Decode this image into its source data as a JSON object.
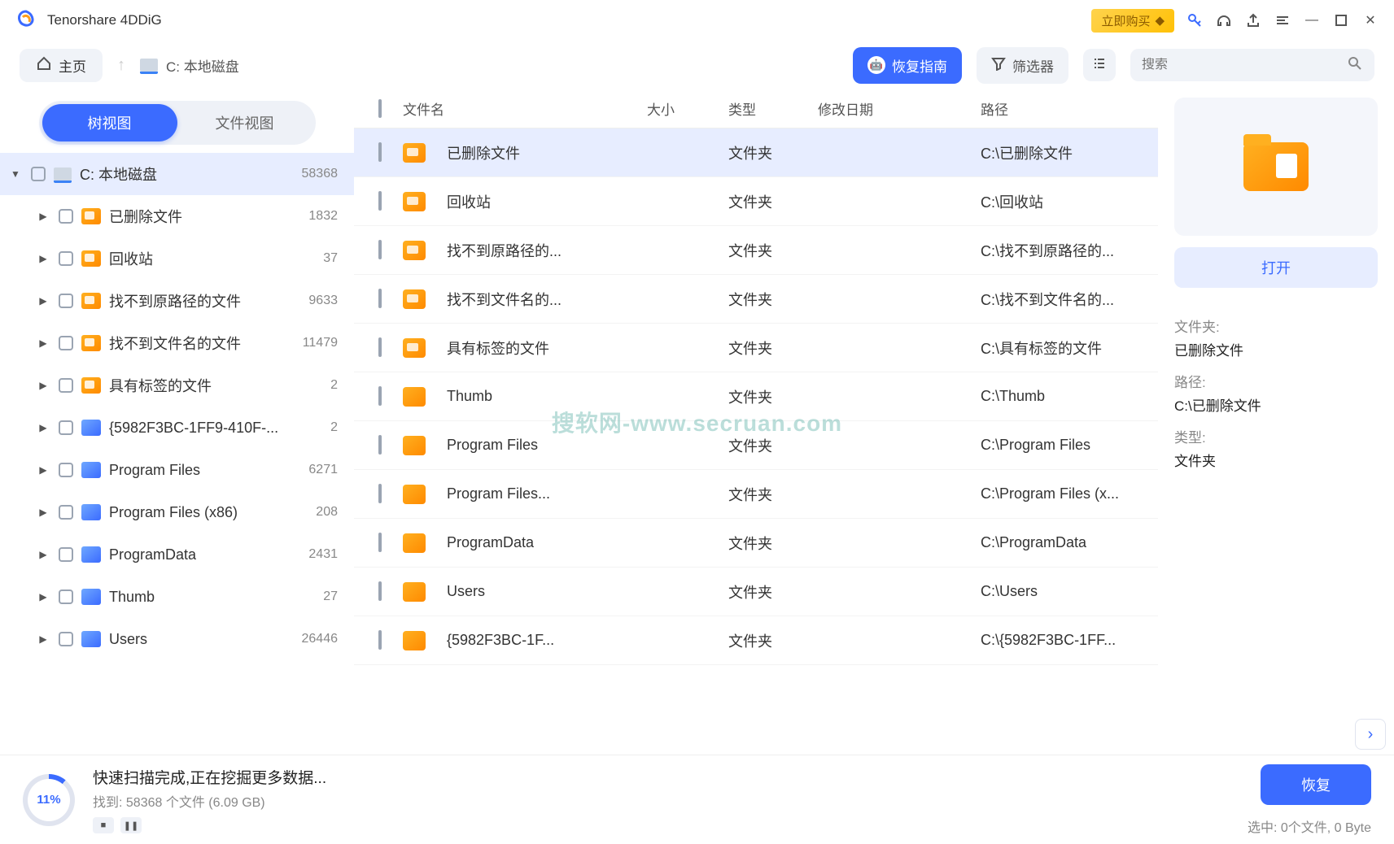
{
  "app": {
    "title": "Tenorshare 4DDiG",
    "buy_label": "立即购买"
  },
  "toolbar": {
    "home": "主页",
    "path": "C: 本地磁盘",
    "guide": "恢复指南",
    "filter": "筛选器",
    "search_placeholder": "搜索"
  },
  "tabs": {
    "tree": "树视图",
    "file": "文件视图"
  },
  "tree": {
    "root": {
      "label": "C: 本地磁盘",
      "count": "58368"
    },
    "children": [
      {
        "label": "已删除文件",
        "count": "1832",
        "iconClass": "folder-orange with-badge"
      },
      {
        "label": "回收站",
        "count": "37",
        "iconClass": "folder-orange with-badge"
      },
      {
        "label": "找不到原路径的文件",
        "count": "9633",
        "iconClass": "folder-orange with-badge"
      },
      {
        "label": "找不到文件名的文件",
        "count": "11479",
        "iconClass": "folder-orange with-badge"
      },
      {
        "label": "具有标签的文件",
        "count": "2",
        "iconClass": "folder-orange with-badge"
      },
      {
        "label": "{5982F3BC-1FF9-410F-...",
        "count": "2",
        "iconClass": "folder-blue"
      },
      {
        "label": "Program Files",
        "count": "6271",
        "iconClass": "folder-blue"
      },
      {
        "label": "Program Files (x86)",
        "count": "208",
        "iconClass": "folder-blue"
      },
      {
        "label": "ProgramData",
        "count": "2431",
        "iconClass": "folder-blue"
      },
      {
        "label": "Thumb",
        "count": "27",
        "iconClass": "folder-blue"
      },
      {
        "label": "Users",
        "count": "26446",
        "iconClass": "folder-blue"
      }
    ]
  },
  "columns": {
    "name": "文件名",
    "size": "大小",
    "type": "类型",
    "date": "修改日期",
    "path": "路径"
  },
  "rows": [
    {
      "name": "已删除文件",
      "type": "文件夹",
      "path": "C:\\已删除文件",
      "selected": true,
      "badge": true
    },
    {
      "name": "回收站",
      "type": "文件夹",
      "path": "C:\\回收站",
      "badge": true
    },
    {
      "name": "找不到原路径的...",
      "type": "文件夹",
      "path": "C:\\找不到原路径的...",
      "badge": true
    },
    {
      "name": "找不到文件名的...",
      "type": "文件夹",
      "path": "C:\\找不到文件名的...",
      "badge": true
    },
    {
      "name": "具有标签的文件",
      "type": "文件夹",
      "path": "C:\\具有标签的文件",
      "badge": true
    },
    {
      "name": "Thumb",
      "type": "文件夹",
      "path": "C:\\Thumb"
    },
    {
      "name": "Program Files",
      "type": "文件夹",
      "path": "C:\\Program Files"
    },
    {
      "name": "Program Files...",
      "type": "文件夹",
      "path": "C:\\Program Files (x..."
    },
    {
      "name": "ProgramData",
      "type": "文件夹",
      "path": "C:\\ProgramData"
    },
    {
      "name": "Users",
      "type": "文件夹",
      "path": "C:\\Users"
    },
    {
      "name": "{5982F3BC-1F...",
      "type": "文件夹",
      "path": "C:\\{5982F3BC-1FF..."
    }
  ],
  "detail": {
    "open": "打开",
    "labels": {
      "folder": "文件夹:",
      "path": "路径:",
      "type": "类型:"
    },
    "values": {
      "folder": "已删除文件",
      "path": "C:\\已删除文件",
      "type": "文件夹"
    }
  },
  "status": {
    "percent": "11%",
    "title": "快速扫描完成,正在挖掘更多数据...",
    "sub": "找到: 58368 个文件 (6.09 GB)",
    "recover": "恢复",
    "selected": "选中: 0个文件, 0 Byte"
  },
  "watermark": "搜软网-www.secruan.com"
}
